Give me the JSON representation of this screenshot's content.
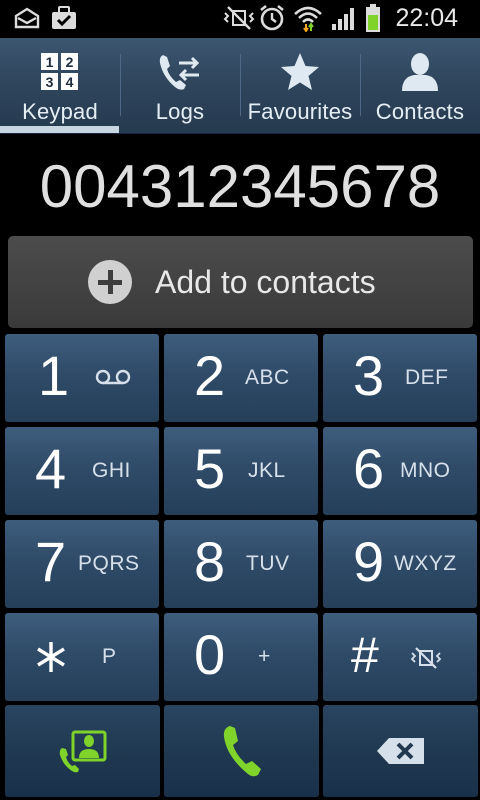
{
  "status_bar": {
    "time": "22:04",
    "icons": [
      "mail-icon",
      "briefcase-check-icon",
      "silent-mode-icon",
      "alarm-icon",
      "wifi-icon",
      "signal-icon",
      "battery-icon"
    ]
  },
  "tabs": [
    {
      "label": "Keypad",
      "icon": "keypad-icon",
      "active": true
    },
    {
      "label": "Logs",
      "icon": "call-logs-icon",
      "active": false
    },
    {
      "label": "Favourites",
      "icon": "star-icon",
      "active": false
    },
    {
      "label": "Contacts",
      "icon": "person-icon",
      "active": false
    }
  ],
  "display": {
    "number": "004312345678"
  },
  "add_contact": {
    "label": "Add to contacts",
    "icon": "plus-circle-icon"
  },
  "keypad": {
    "keys": [
      {
        "digit": "1",
        "letters": "",
        "icon": "voicemail-icon"
      },
      {
        "digit": "2",
        "letters": "ABC"
      },
      {
        "digit": "3",
        "letters": "DEF"
      },
      {
        "digit": "4",
        "letters": "GHI"
      },
      {
        "digit": "5",
        "letters": "JKL"
      },
      {
        "digit": "6",
        "letters": "MNO"
      },
      {
        "digit": "7",
        "letters": "PQRS"
      },
      {
        "digit": "8",
        "letters": "TUV"
      },
      {
        "digit": "9",
        "letters": "WXYZ"
      },
      {
        "digit": "*",
        "letters": "P"
      },
      {
        "digit": "0",
        "letters": "+"
      },
      {
        "digit": "#",
        "letters": "",
        "icon": "mute-vibrate-icon"
      }
    ]
  },
  "actions": {
    "contacts_icon": "contact-card-icon",
    "call_icon": "phone-call-icon",
    "backspace_icon": "backspace-icon"
  },
  "colors": {
    "accent_green": "#7fd32b",
    "key_blue": "#2f4b68",
    "tab_underline": "#c8d6e2"
  }
}
